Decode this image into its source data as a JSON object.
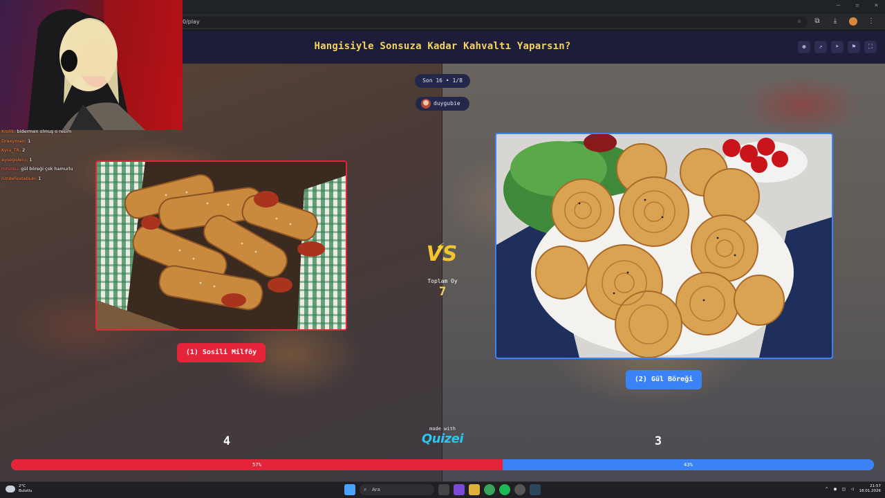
{
  "browser": {
    "url": "0/play",
    "window_controls": [
      "–",
      "▫",
      "✕"
    ]
  },
  "quiz": {
    "title": "Hangisiyle Sonsuza Kadar Kahvaltı Yaparsın?",
    "round": "Son 16 • 1/8",
    "username": "duygubie",
    "total_label": "Toplam Oy",
    "total_votes": "7",
    "vs_text": "VS",
    "made_with": "made with",
    "brand": "Quizei",
    "left": {
      "label": "(1) Sosili Milföy",
      "votes": "4",
      "percent_label": "57%",
      "share": 0.57
    },
    "right": {
      "label": "(2) Gül Böreği",
      "votes": "3",
      "percent_label": "43%",
      "share": 0.43
    },
    "colors": {
      "left": "#e5243a",
      "right": "#3b82f6",
      "title": "#f4d35e"
    }
  },
  "chat": [
    {
      "user": "Krolik:",
      "msg": "bidermen olmuş o resim",
      "color": "#ff7b3a"
    },
    {
      "user": "Draxyman:",
      "msg": "1",
      "color": "#ff7b3a"
    },
    {
      "user": "Kyra_TR:",
      "msg": "2",
      "color": "#ff7b3a"
    },
    {
      "user": "ayseguleru:",
      "msg": "1",
      "color": "#ff7b3a"
    },
    {
      "user": "mrsnsu:",
      "msg": "gül böreği çok hamurlu",
      "color": "#ff5a5a"
    },
    {
      "user": "iUndefeatabLei:",
      "msg": "1",
      "color": "#ff7b3a"
    }
  ],
  "taskbar": {
    "weather_temp": "2°C",
    "weather_desc": "Bulutlu",
    "search_placeholder": "Ara",
    "time": "21:57",
    "date": "18.01.2026"
  }
}
